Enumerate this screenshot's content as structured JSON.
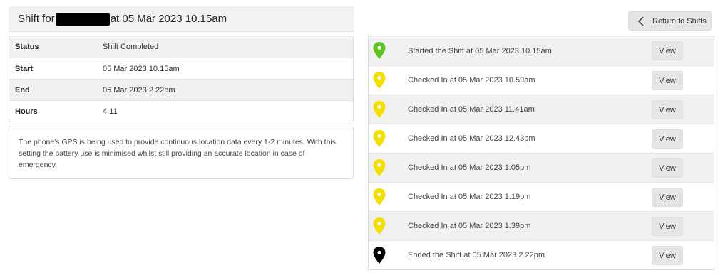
{
  "header": {
    "title_prefix": "Shift for",
    "title_suffix": "at 05 Mar 2023 10.15am"
  },
  "info": [
    {
      "label": "Status",
      "value": "Shift Completed"
    },
    {
      "label": "Start",
      "value": "05 Mar 2023 10.15am"
    },
    {
      "label": "End",
      "value": "05 Mar 2023 2.22pm"
    },
    {
      "label": "Hours",
      "value": "4.11"
    }
  ],
  "gps_note": "The phone's GPS is being used to provide continuous location data every 1-2 minutes. With this setting the battery use is minimised whilst still providing an accurate location in case of emergency.",
  "return_button": {
    "label": "Return to Shifts",
    "icon": "chevron-left-icon"
  },
  "colors": {
    "start_pin": "#5cc31f",
    "checkin_pin": "#f3df00",
    "end_pin": "#000000"
  },
  "events": [
    {
      "text": "Started the Shift at 05 Mar 2023 10.15am",
      "pin": "start",
      "button": "View"
    },
    {
      "text": "Checked In at 05 Mar 2023 10.59am",
      "pin": "checkin",
      "button": "View"
    },
    {
      "text": "Checked In at 05 Mar 2023 11.41am",
      "pin": "checkin",
      "button": "View"
    },
    {
      "text": "Checked In at 05 Mar 2023 12.43pm",
      "pin": "checkin",
      "button": "View"
    },
    {
      "text": "Checked In at 05 Mar 2023 1.05pm",
      "pin": "checkin",
      "button": "View"
    },
    {
      "text": "Checked In at 05 Mar 2023 1.19pm",
      "pin": "checkin",
      "button": "View"
    },
    {
      "text": "Checked In at 05 Mar 2023 1.39pm",
      "pin": "checkin",
      "button": "View"
    },
    {
      "text": "Ended the Shift at 05 Mar 2023 2.22pm",
      "pin": "end",
      "button": "View"
    }
  ]
}
